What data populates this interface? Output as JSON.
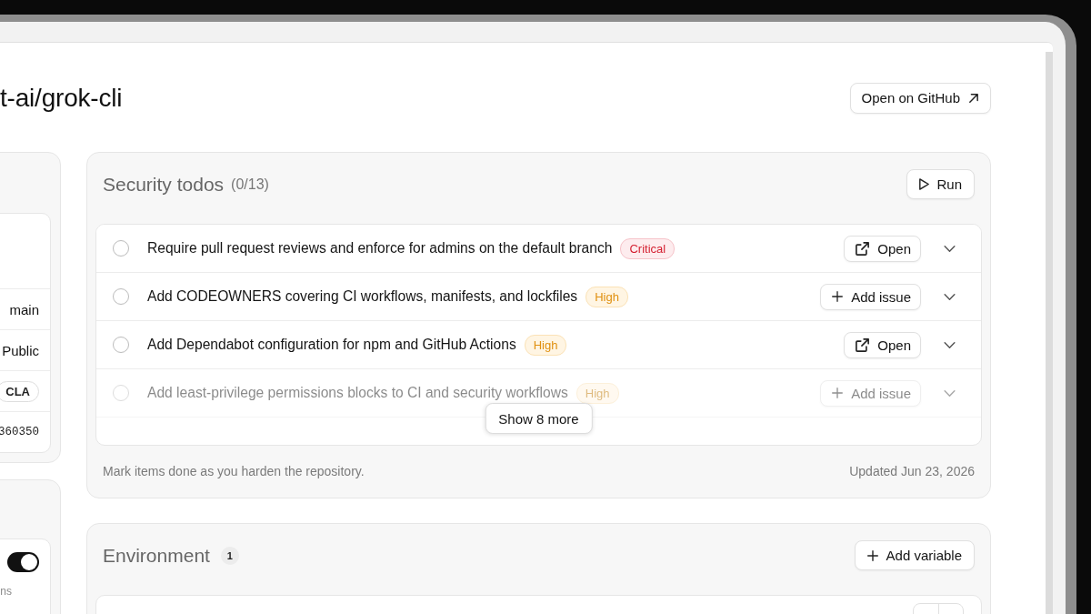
{
  "header": {
    "title": "t-ai/grok-cli",
    "open_button": "Open on GitHub"
  },
  "left_panel": {
    "rows": [
      {
        "kind": "text",
        "value": "main"
      },
      {
        "kind": "text",
        "value": "Public"
      },
      {
        "kind": "badge",
        "value": "CLA"
      },
      {
        "kind": "mono",
        "value": "360350"
      }
    ]
  },
  "left_panel_2": {
    "toggle": {
      "on": true
    },
    "caption": "ns"
  },
  "security_todos": {
    "title": "Security todos",
    "count": "(0/13)",
    "run_button": "Run",
    "items": [
      {
        "text": "Require pull request reviews and enforce for admins on the default branch",
        "checked": false,
        "severity": {
          "kind": "critical",
          "label": "Critical"
        },
        "action": {
          "kind": "open",
          "label": "Open"
        },
        "faded": false
      },
      {
        "text": "Add CODEOWNERS covering CI workflows, manifests, and lockfiles",
        "checked": false,
        "severity": {
          "kind": "high",
          "label": "High"
        },
        "action": {
          "kind": "add_issue",
          "label": "Add issue"
        },
        "faded": false
      },
      {
        "text": "Add Dependabot configuration for npm and GitHub Actions",
        "checked": false,
        "severity": {
          "kind": "high",
          "label": "High"
        },
        "action": {
          "kind": "open",
          "label": "Open"
        },
        "faded": false
      },
      {
        "text": "Add least-privilege permissions blocks to CI and security workflows",
        "checked": false,
        "severity": {
          "kind": "high",
          "label": "High"
        },
        "action": {
          "kind": "add_issue",
          "label": "Add issue"
        },
        "faded": true
      }
    ],
    "show_more": "Show 8 more",
    "footer_note": "Mark items done as you harden the repository.",
    "updated": "Updated Jun 23, 2026"
  },
  "environment": {
    "title": "Environment",
    "count": "1",
    "add_button": "Add variable"
  }
}
